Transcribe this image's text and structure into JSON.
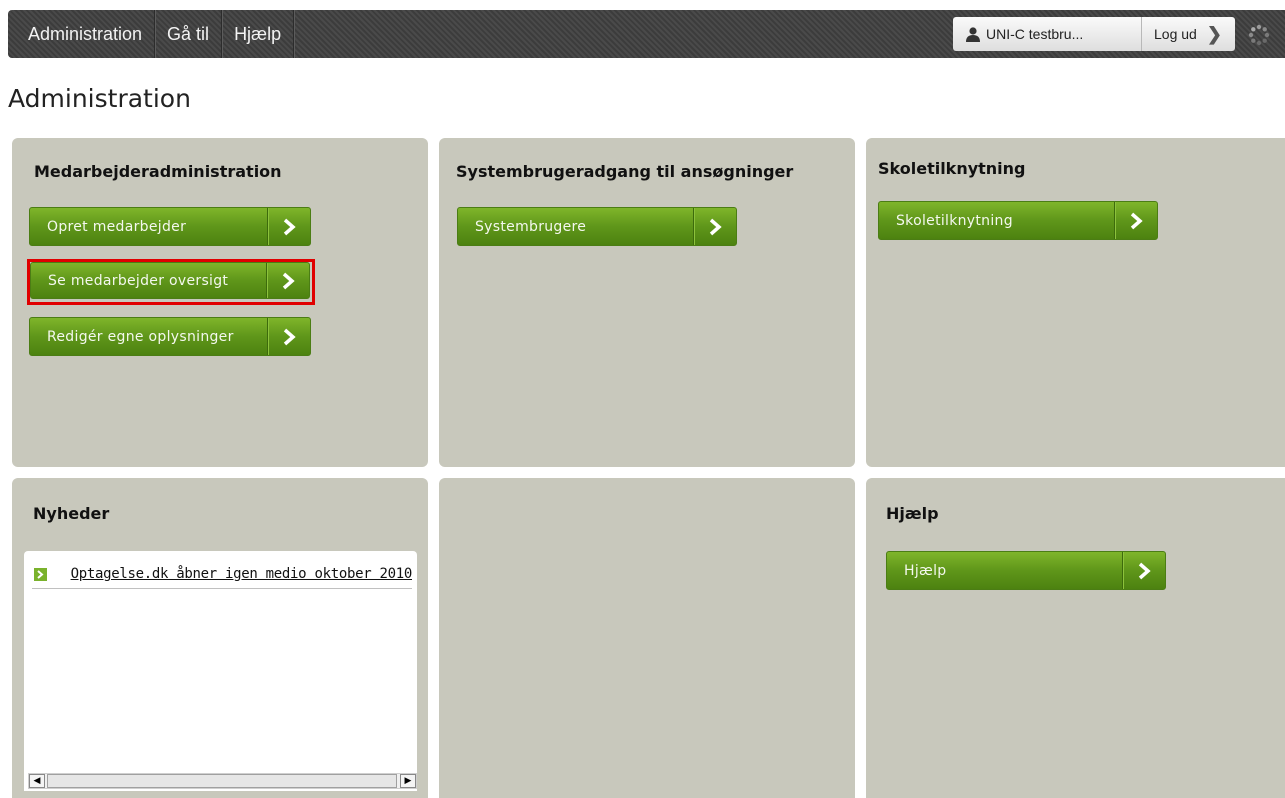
{
  "topbar": {
    "menu": [
      "Administration",
      "Gå til",
      "Hjælp"
    ],
    "user_label": "UNI-C testbru...",
    "logout_label": "Log ud"
  },
  "page_title": "Administration",
  "panels": {
    "medarbejder": {
      "title": "Medarbejderadministration",
      "buttons": [
        "Opret medarbejder",
        "Se medarbejder oversigt",
        "Redigér egne oplysninger"
      ]
    },
    "systembruger": {
      "title": "Systembrugeradgang til ansøgninger",
      "buttons": [
        "Systembrugere"
      ]
    },
    "skole": {
      "title": "Skoletilknytning",
      "buttons": [
        "Skoletilknytning"
      ]
    },
    "nyheder": {
      "title": "Nyheder",
      "items": [
        "Optagelse.dk åbner igen medio oktober 2010"
      ]
    },
    "hjaelp": {
      "title": "Hjælp",
      "buttons": [
        "Hjælp"
      ]
    }
  },
  "colors": {
    "panel_bg": "#c8c8bc",
    "button_green": "#5f961a",
    "highlight": "#e00000"
  }
}
